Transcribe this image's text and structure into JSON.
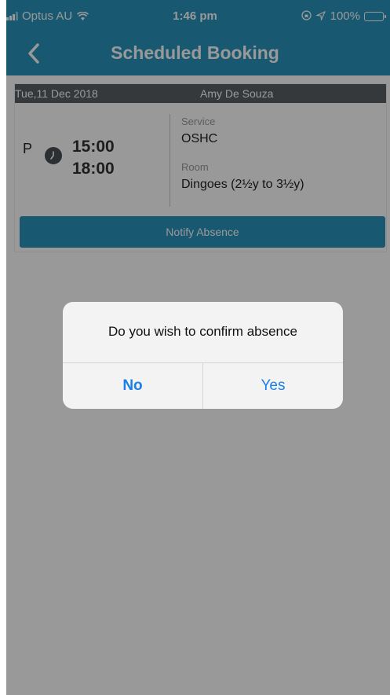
{
  "status_bar": {
    "carrier": "Optus AU",
    "time": "1:46 pm",
    "battery": "100%"
  },
  "nav": {
    "title": "Scheduled Booking"
  },
  "booking": {
    "date": "Tue,11 Dec 2018",
    "child_name": "Amy De Souza",
    "slot": "P",
    "start_time": "15:00",
    "end_time": "18:00",
    "service_label": "Service",
    "service_value": "OSHC",
    "room_label": "Room",
    "room_value": "Dingoes (2½y to 3½y)",
    "notify_label": "Notify Absence"
  },
  "dialog": {
    "message": "Do you wish to confirm absence",
    "no_label": "No",
    "yes_label": "Yes"
  },
  "colors": {
    "brand": "#2a93bd",
    "dialog_button": "#1a7fe8",
    "header_gray": "#5a5f63"
  }
}
